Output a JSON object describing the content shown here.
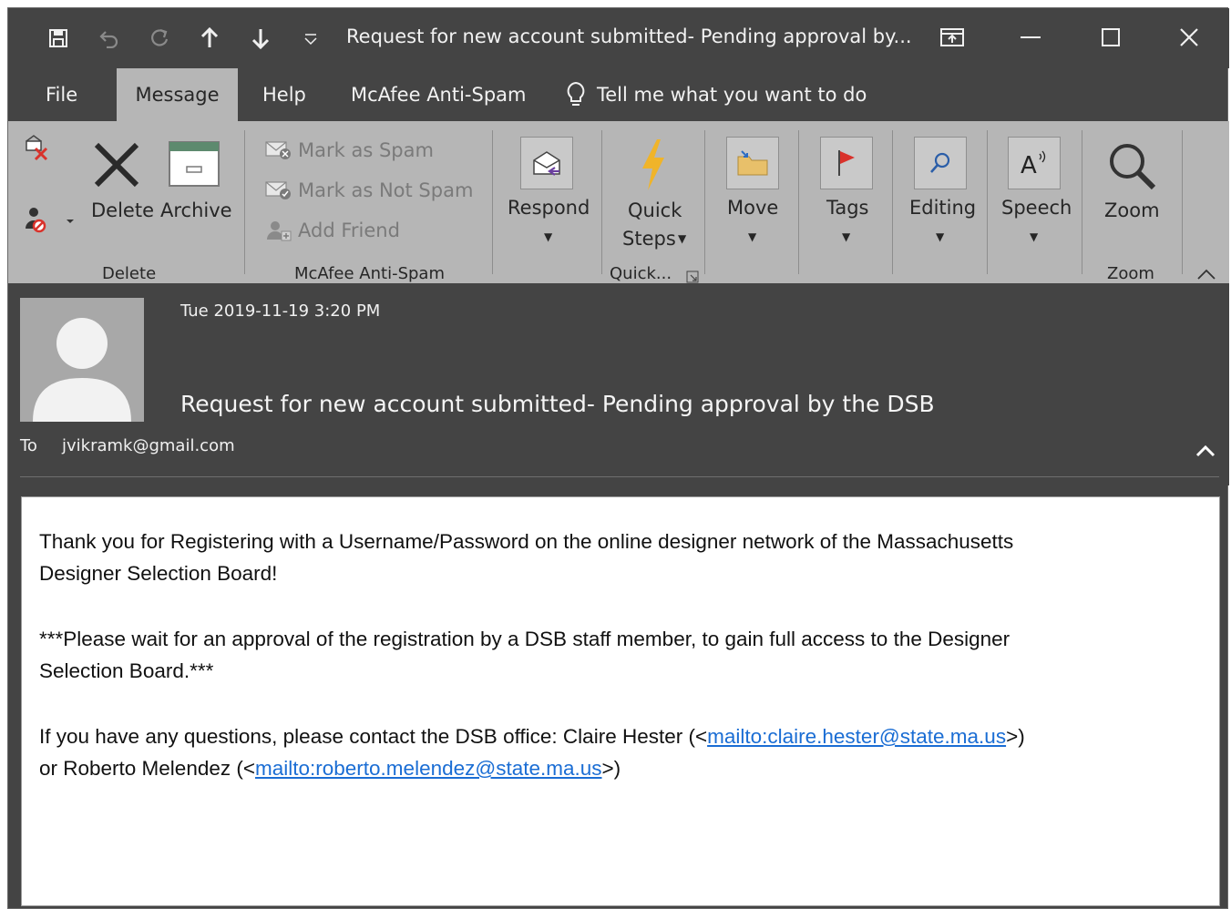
{
  "titlebar": {
    "title": "Request for new account submitted- Pending approval by...",
    "qat": [
      "save-icon",
      "undo-icon",
      "redo-icon",
      "up-arrow-icon",
      "down-arrow-icon",
      "customize-icon"
    ]
  },
  "tabs": [
    "File",
    "Message",
    "Help",
    "McAfee Anti-Spam"
  ],
  "active_tab": "Message",
  "tell_me": "Tell me what you want to do",
  "ribbon": {
    "delete_group": {
      "label": "Delete",
      "delete": "Delete",
      "archive": "Archive"
    },
    "mcafee_group": {
      "label": "McAfee Anti-Spam",
      "mark_spam": "Mark as Spam",
      "mark_not_spam": "Mark as Not Spam",
      "add_friend": "Add Friend"
    },
    "respond": "Respond",
    "quick_steps": {
      "line1": "Quick",
      "line2": "Steps",
      "group_label": "Quick..."
    },
    "move": "Move",
    "tags": "Tags",
    "editing": "Editing",
    "speech": "Speech",
    "zoom": {
      "label": "Zoom",
      "group_label": "Zoom"
    }
  },
  "message": {
    "date": "Tue 2019-11-19 3:20 PM",
    "subject": "Request for new account submitted- Pending approval by the DSB",
    "to_label": "To",
    "to": "jvikramk@gmail.com",
    "body": {
      "p1_line1": "Thank you for Registering with a Username/Password on the online designer network of the Massachusetts",
      "p1_line2": "Designer Selection Board!",
      "p2_line1": "***Please wait for an approval of the registration by a DSB staff member, to gain full access to the Designer",
      "p2_line2": "Selection Board.***",
      "p3_pre": "If you have any questions, please contact the DSB office: Claire Hester (<",
      "p3_link1": "mailto:claire.hester@state.ma.us",
      "p3_post1": ">)",
      "p3_line2_pre": "or Roberto Melendez (<",
      "p3_link2": "mailto:roberto.melendez@state.ma.us",
      "p3_post2": ">)"
    }
  },
  "colors": {
    "window_bg": "#444444",
    "ribbon_bg": "#b6b6b6",
    "link": "#1a6dd4",
    "flag_red": "#d9322b",
    "lightning": "#f0b429"
  }
}
